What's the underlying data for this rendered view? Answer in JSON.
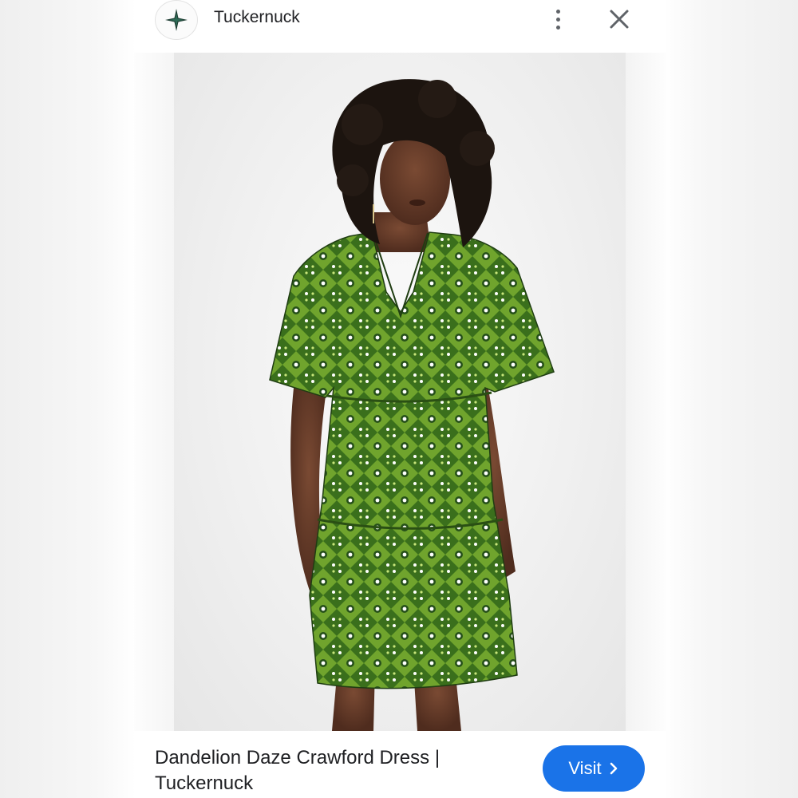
{
  "header": {
    "site_name": "Tuckernuck",
    "logo_icon": "tuckernuck-star-logo",
    "more_icon": "more-vertical-icon",
    "close_icon": "close-icon"
  },
  "image": {
    "subject": "model wearing green printed tiered dress"
  },
  "footer": {
    "title": "Dandelion Daze Crawford Dress | Tuckernuck",
    "visit_label": "Visit",
    "visit_icon": "chevron-right-icon"
  },
  "colors": {
    "accent": "#1a73e8",
    "dress_green": "#3f7a1f",
    "dress_light": "#9ccf3a"
  }
}
